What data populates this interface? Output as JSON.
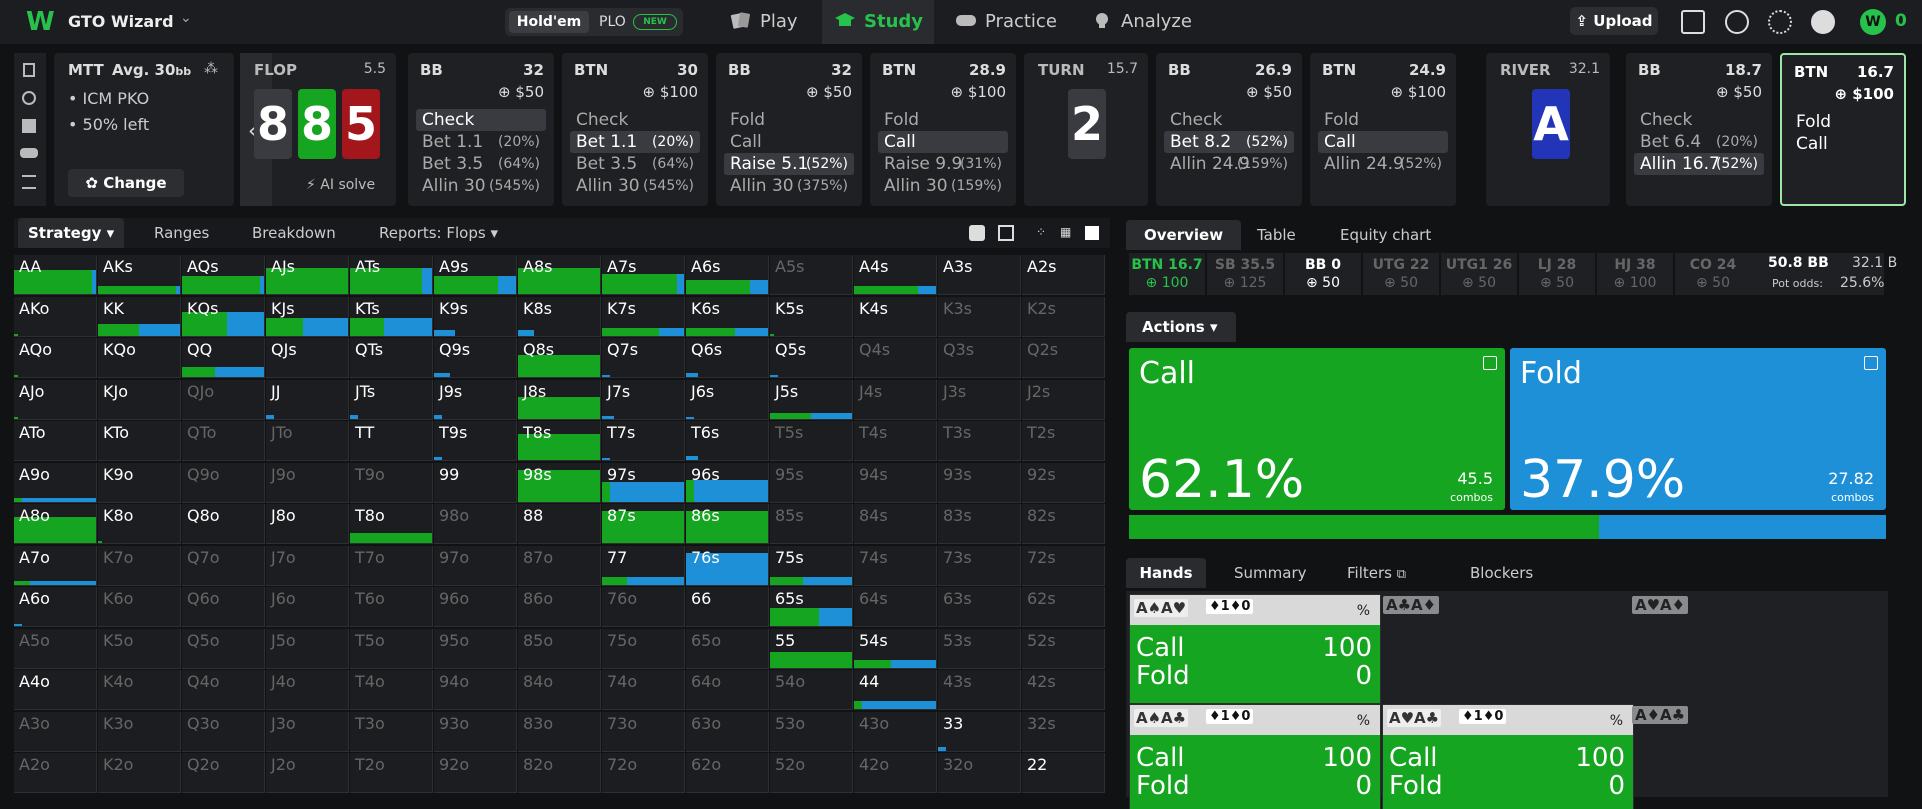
{
  "header": {
    "brand": "GTO Wizard",
    "seg_holdem": "Hold'em",
    "seg_plo": "PLO",
    "new_badge": "NEW",
    "nav": [
      {
        "label": "Play"
      },
      {
        "label": "Study"
      },
      {
        "label": "Practice"
      },
      {
        "label": "Analyze"
      }
    ],
    "upload": "Upload",
    "coins": "0",
    "colors": {
      "accent": "#27c24c",
      "bg": "#1c1d20"
    }
  },
  "spot": {
    "format": "MTT",
    "avg": "Avg. 30",
    "avg_unit": "bb",
    "opts": [
      "• ICM PKO",
      "• 50% left"
    ],
    "change": "Change"
  },
  "flop": {
    "street": "FLOP",
    "pot": "5.5",
    "cards": [
      "8",
      "8",
      "5"
    ],
    "ai_solve": "AI solve"
  },
  "actions": [
    {
      "pos": "BB",
      "stack": "32",
      "pot": "$50",
      "acts": [
        {
          "t": "Check",
          "p": "",
          "sel": true
        },
        {
          "t": "Bet 1.1",
          "p": "(20%)"
        },
        {
          "t": "Bet 3.5",
          "p": "(64%)"
        },
        {
          "t": "Allin 30",
          "p": "(545%)"
        }
      ]
    },
    {
      "pos": "BTN",
      "stack": "30",
      "pot": "$100",
      "acts": [
        {
          "t": "Check",
          "p": ""
        },
        {
          "t": "Bet 1.1",
          "p": "(20%)",
          "sel": true
        },
        {
          "t": "Bet 3.5",
          "p": "(64%)"
        },
        {
          "t": "Allin 30",
          "p": "(545%)"
        }
      ]
    },
    {
      "pos": "BB",
      "stack": "32",
      "pot": "$50",
      "acts": [
        {
          "t": "Fold",
          "p": ""
        },
        {
          "t": "Call",
          "p": ""
        },
        {
          "t": "Raise 5.1",
          "p": "(52%)",
          "sel": true
        },
        {
          "t": "Allin 30",
          "p": "(375%)"
        }
      ]
    },
    {
      "pos": "BTN",
      "stack": "28.9",
      "pot": "$100",
      "acts": [
        {
          "t": "Fold",
          "p": ""
        },
        {
          "t": "Call",
          "p": "",
          "sel": true
        },
        {
          "t": "Raise 9.9",
          "p": "(31%)"
        },
        {
          "t": "Allin 30",
          "p": "(159%)"
        }
      ]
    },
    {
      "pos": "BB",
      "stack": "26.9",
      "pot": "$50",
      "acts": [
        {
          "t": "Check",
          "p": ""
        },
        {
          "t": "Bet 8.2",
          "p": "(52%)",
          "sel": true
        },
        {
          "t": "Allin 24.9",
          "p": "(159%)"
        }
      ]
    },
    {
      "pos": "BTN",
      "stack": "24.9",
      "pot": "$100",
      "acts": [
        {
          "t": "Fold",
          "p": ""
        },
        {
          "t": "Call",
          "p": "",
          "sel": true
        },
        {
          "t": "Allin 24.9",
          "p": "(52%)"
        }
      ]
    },
    {
      "pos": "BB",
      "stack": "18.7",
      "pot": "$50",
      "acts": [
        {
          "t": "Check",
          "p": ""
        },
        {
          "t": "Bet 6.4",
          "p": "(20%)"
        },
        {
          "t": "Allin 16.7",
          "p": "(52%)",
          "sel": true
        }
      ]
    },
    {
      "pos": "BTN",
      "stack": "16.7",
      "pot": "$100",
      "acts": [
        {
          "t": "Fold",
          "p": ""
        },
        {
          "t": "Call",
          "p": ""
        }
      ]
    }
  ],
  "turn": {
    "street": "TURN",
    "pot": "15.7",
    "card": "2"
  },
  "river": {
    "street": "RIVER",
    "pot": "32.1",
    "card": "A"
  },
  "tabs": [
    "Strategy",
    "Ranges",
    "Breakdown",
    "Reports: Flops"
  ],
  "grid_rows": [
    [
      "AA",
      "AKs",
      "AQs",
      "AJs",
      "ATs",
      "A9s",
      "A8s",
      "A7s",
      "A6s",
      "A5s",
      "A4s",
      "A3s",
      "A2s"
    ],
    [
      "AKo",
      "KK",
      "KQs",
      "KJs",
      "KTs",
      "K9s",
      "K8s",
      "K7s",
      "K6s",
      "K5s",
      "K4s",
      "K3s",
      "K2s"
    ],
    [
      "AQo",
      "KQo",
      "QQ",
      "QJs",
      "QTs",
      "Q9s",
      "Q8s",
      "Q7s",
      "Q6s",
      "Q5s",
      "Q4s",
      "Q3s",
      "Q2s"
    ],
    [
      "AJo",
      "KJo",
      "QJo",
      "JJ",
      "JTs",
      "J9s",
      "J8s",
      "J7s",
      "J6s",
      "J5s",
      "J4s",
      "J3s",
      "J2s"
    ],
    [
      "ATo",
      "KTo",
      "QTo",
      "JTo",
      "TT",
      "T9s",
      "T8s",
      "T7s",
      "T6s",
      "T5s",
      "T4s",
      "T3s",
      "T2s"
    ],
    [
      "A9o",
      "K9o",
      "Q9o",
      "J9o",
      "T9o",
      "99",
      "98s",
      "97s",
      "96s",
      "95s",
      "94s",
      "93s",
      "92s"
    ],
    [
      "A8o",
      "K8o",
      "Q8o",
      "J8o",
      "T8o",
      "98o",
      "88",
      "87s",
      "86s",
      "85s",
      "84s",
      "83s",
      "82s"
    ],
    [
      "A7o",
      "K7o",
      "Q7o",
      "J7o",
      "T7o",
      "97o",
      "87o",
      "77",
      "76s",
      "75s",
      "74s",
      "73s",
      "72s"
    ],
    [
      "A6o",
      "K6o",
      "Q6o",
      "J6o",
      "T6o",
      "96o",
      "86o",
      "76o",
      "66",
      "65s",
      "64s",
      "63s",
      "62s"
    ],
    [
      "A5o",
      "K5o",
      "Q5o",
      "J5o",
      "T5o",
      "95o",
      "85o",
      "75o",
      "65o",
      "55",
      "54s",
      "53s",
      "52s"
    ],
    [
      "A4o",
      "K4o",
      "Q4o",
      "J4o",
      "T4o",
      "94o",
      "84o",
      "74o",
      "64o",
      "54o",
      "44",
      "43s",
      "42s"
    ],
    [
      "A3o",
      "K3o",
      "Q3o",
      "J3o",
      "T3o",
      "93o",
      "83o",
      "73o",
      "63o",
      "53o",
      "43o",
      "33",
      "32s"
    ],
    [
      "A2o",
      "K2o",
      "Q2o",
      "J2o",
      "T2o",
      "92o",
      "82o",
      "72o",
      "62o",
      "52o",
      "42o",
      "32o",
      "22"
    ]
  ],
  "right_tabs": [
    "Overview",
    "Table",
    "Equity chart"
  ],
  "players": [
    {
      "pos": "BTN 16.7",
      "val": "100"
    },
    {
      "pos": "SB 35.5",
      "val": "125"
    },
    {
      "pos": "BB 0",
      "val": "50"
    },
    {
      "pos": "UTG 22",
      "val": "50"
    },
    {
      "pos": "UTG1 26",
      "val": "50"
    },
    {
      "pos": "LJ 28",
      "val": "50"
    },
    {
      "pos": "HJ 38",
      "val": "100"
    },
    {
      "pos": "CO 24",
      "val": "50"
    }
  ],
  "pot_info": {
    "pot": "50.8 BB",
    "pot_alt": "32.1 B",
    "pot_odds_label": "Pot odds:",
    "pot_odds": "25.6%"
  },
  "actions_dropdown": "Actions",
  "call": {
    "name": "Call",
    "pct": "62.1%",
    "combos": "45.5",
    "combos_label": "combos",
    "color": "#15a520"
  },
  "fold": {
    "name": "Fold",
    "pct": "37.9%",
    "combos": "27.82",
    "combos_label": "combos",
    "color": "#1e90d8"
  },
  "hand_tabs": [
    "Hands",
    "Summary",
    "Filters",
    "Blockers"
  ],
  "hands": [
    {
      "cards": "A♠A♥",
      "blk": "♦1♦0",
      "call": "100",
      "fold": "0"
    },
    {
      "cards": "A♠A♣",
      "blk": "♦1♦0",
      "call": "100",
      "fold": "0"
    },
    {
      "cards": "A♥A♣",
      "blk": "♦1♦0",
      "call": "100",
      "fold": "0"
    }
  ],
  "empty_hands": [
    "A♣A♦",
    "A♥A♦",
    "A♦A♣"
  ]
}
